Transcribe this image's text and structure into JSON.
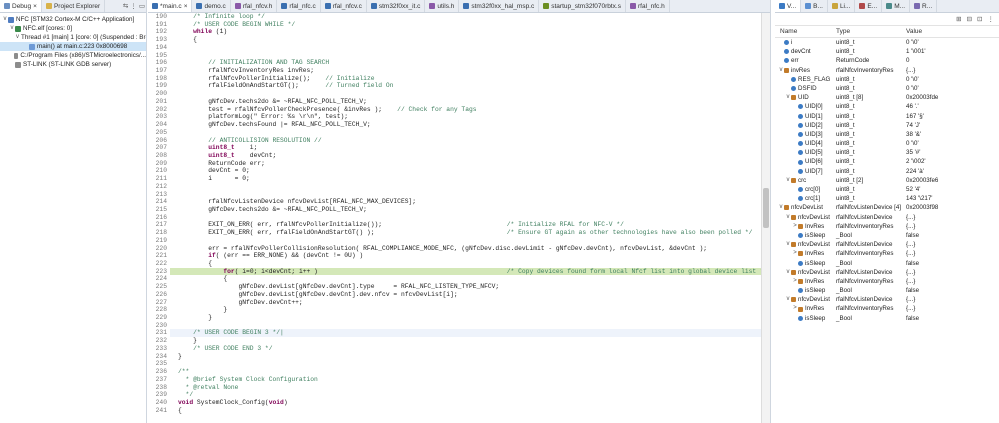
{
  "debug_view": {
    "tabs": [
      "Debug",
      "Project Explorer"
    ],
    "tree": [
      {
        "indent": 0,
        "twisty": "v",
        "label": "NFC [STM32 Cortex-M C/C++ Application]",
        "icon": "app"
      },
      {
        "indent": 1,
        "twisty": "v",
        "label": "NFC.elf [cores: 0]",
        "icon": "elf"
      },
      {
        "indent": 2,
        "twisty": "v",
        "label": "Thread #1 [main] 1 [core: 0] (Suspended : Breakpoint)",
        "icon": "thread"
      },
      {
        "indent": 3,
        "twisty": "",
        "label": "main() at main.c:223 0x8000698",
        "icon": "frame",
        "selected": true
      },
      {
        "indent": 1,
        "twisty": "",
        "label": "C:/Program Files (x86)/STMicroelectronics/...",
        "icon": "gdb"
      },
      {
        "indent": 1,
        "twisty": "",
        "label": "ST-LINK (ST-LINK GDB server)",
        "icon": "gdb"
      }
    ]
  },
  "editor": {
    "tabs": [
      {
        "label": "*main.c",
        "close": "×",
        "kind": "c",
        "active": true
      },
      {
        "label": "demo.c",
        "kind": "c"
      },
      {
        "label": "rfal_nfcv.h",
        "kind": "h"
      },
      {
        "label": "rfal_nfc.c",
        "kind": "c"
      },
      {
        "label": "rfal_nfcv.c",
        "kind": "c"
      },
      {
        "label": "stm32f0xx_it.c",
        "kind": "c"
      },
      {
        "label": "utils.h",
        "kind": "h"
      },
      {
        "label": "stm32f0xx_hal_msp.c",
        "kind": "c"
      },
      {
        "label": "startup_stm32f070rbtx.s",
        "kind": "s"
      },
      {
        "label": "rfal_nfc.h",
        "kind": "h"
      }
    ],
    "lines": [
      {
        "n": "190",
        "t": "    /* Infinite loop */"
      },
      {
        "n": "191",
        "t": "    /* USER CODE BEGIN WHILE */"
      },
      {
        "n": "192",
        "t": "    while (1)"
      },
      {
        "n": "193",
        "t": "    {"
      },
      {
        "n": "194",
        "t": ""
      },
      {
        "n": "195",
        "t": ""
      },
      {
        "n": "196",
        "t": "        // INITIALIZATION AND TAG SEARCH"
      },
      {
        "n": "197",
        "t": "        rfalNfcvInventoryRes invRes;"
      },
      {
        "n": "198",
        "t": "        rfalNfcvPollerInitialize();    // Initialize"
      },
      {
        "n": "199",
        "t": "        rfalFieldOnAndStartGT();       // Turned field On"
      },
      {
        "n": "200",
        "t": ""
      },
      {
        "n": "201",
        "t": "        gNfcDev.techs2do &= ~RFAL_NFC_POLL_TECH_V;"
      },
      {
        "n": "202",
        "t": "        test = rfalNfcvPollerCheckPresence( &invRes );    // Check for any Tags"
      },
      {
        "n": "203",
        "t": "        platformLog(\" Error: %s \\r\\n\", test);"
      },
      {
        "n": "204",
        "t": "        gNfcDev.techsFound |= RFAL_NFC_POLL_TECH_V;"
      },
      {
        "n": "205",
        "t": ""
      },
      {
        "n": "206",
        "t": "        // ANTICOLLISION RESOLUTION //"
      },
      {
        "n": "207",
        "t": "        uint8_t    i;"
      },
      {
        "n": "208",
        "t": "        uint8_t    devCnt;"
      },
      {
        "n": "209",
        "t": "        ReturnCode err;"
      },
      {
        "n": "210",
        "t": "        devCnt = 0;"
      },
      {
        "n": "211",
        "t": "        i      = 0;"
      },
      {
        "n": "212",
        "t": ""
      },
      {
        "n": "213",
        "t": ""
      },
      {
        "n": "214",
        "t": "        rfalNfcvListenDevice nfcvDevList[RFAL_NFC_MAX_DEVICES];"
      },
      {
        "n": "215",
        "t": "        gNfcDev.techs2do &= ~RFAL_NFC_POLL_TECH_V;"
      },
      {
        "n": "216",
        "t": ""
      },
      {
        "n": "217",
        "t": "        EXIT_ON_ERR( err, rfalNfcvPollerInitialize());                                 /* Initialize RFAL for NFC-V */"
      },
      {
        "n": "218",
        "t": "        EXIT_ON_ERR( err, rfalFieldOnAndStartGT() );                                   /* Ensure GT again as other technologies have also been polled */"
      },
      {
        "n": "219",
        "t": ""
      },
      {
        "n": "220",
        "t": "        err = rfalNfcvPollerCollisionResolution( RFAL_COMPLIANCE_MODE_NFC, (gNfcDev.disc.devLimit - gNfcDev.devCnt), nfcvDevList, &devCnt );"
      },
      {
        "n": "221",
        "t": "        if( (err == ERR_NONE) && (devCnt != 0U) )"
      },
      {
        "n": "222",
        "t": "        {"
      },
      {
        "n": "223",
        "t": "            for( i=0; i<devCnt; i++ )                                                  /* Copy devices found form local Nfcf list into global device list */",
        "hl": true
      },
      {
        "n": "224",
        "t": "            {"
      },
      {
        "n": "225",
        "t": "                gNfcDev.devList[gNfcDev.devCnt].type     = RFAL_NFC_LISTEN_TYPE_NFCV;"
      },
      {
        "n": "226",
        "t": "                gNfcDev.devList[gNfcDev.devCnt].dev.nfcv = nfcvDevList[i];"
      },
      {
        "n": "227",
        "t": "                gNfcDev.devCnt++;"
      },
      {
        "n": "228",
        "t": "            }"
      },
      {
        "n": "229",
        "t": "        }"
      },
      {
        "n": "230",
        "t": ""
      },
      {
        "n": "231",
        "t": "    /* USER CODE BEGIN 3 */|",
        "cur": true
      },
      {
        "n": "232",
        "t": "    }"
      },
      {
        "n": "233",
        "t": "    /* USER CODE END 3 */"
      },
      {
        "n": "234",
        "t": "}"
      },
      {
        "n": "235",
        "t": ""
      },
      {
        "n": "236",
        "t": "/**"
      },
      {
        "n": "237",
        "t": "  * @brief System Clock Configuration"
      },
      {
        "n": "238",
        "t": "  * @retval None"
      },
      {
        "n": "239",
        "t": "  */"
      },
      {
        "n": "240",
        "t": "void SystemClock_Config(void)"
      },
      {
        "n": "241",
        "t": "{"
      }
    ]
  },
  "variables_view": {
    "tabs": [
      "V...",
      "B...",
      "Li...",
      "E...",
      "M...",
      "R..."
    ],
    "columns": [
      "Name",
      "Type",
      "Value"
    ],
    "rows": [
      {
        "d": 0,
        "tw": "",
        "name": "i",
        "type": "uint8_t",
        "value": "0 '\\0'"
      },
      {
        "d": 0,
        "tw": "",
        "name": "devCnt",
        "type": "uint8_t",
        "value": "1 '\\001'"
      },
      {
        "d": 0,
        "tw": "",
        "name": "err",
        "type": "ReturnCode",
        "value": "0"
      },
      {
        "d": 0,
        "tw": "v",
        "name": "invRes",
        "type": "rfalNfcvInventoryRes",
        "value": "{...}",
        "struct": true
      },
      {
        "d": 1,
        "tw": "",
        "name": "RES_FLAG",
        "type": "uint8_t",
        "value": "0 '\\0'"
      },
      {
        "d": 1,
        "tw": "",
        "name": "DSFID",
        "type": "uint8_t",
        "value": "0 '\\0'"
      },
      {
        "d": 1,
        "tw": "v",
        "name": "UID",
        "type": "uint8_t [8]",
        "value": "0x20003fde",
        "struct": true
      },
      {
        "d": 2,
        "tw": "",
        "name": "UID[0]",
        "type": "uint8_t",
        "value": "46 '.'"
      },
      {
        "d": 2,
        "tw": "",
        "name": "UID[1]",
        "type": "uint8_t",
        "value": "167 '§'"
      },
      {
        "d": 2,
        "tw": "",
        "name": "UID[2]",
        "type": "uint8_t",
        "value": "74 'J'"
      },
      {
        "d": 2,
        "tw": "",
        "name": "UID[3]",
        "type": "uint8_t",
        "value": "38 '&'"
      },
      {
        "d": 2,
        "tw": "",
        "name": "UID[4]",
        "type": "uint8_t",
        "value": "0 '\\0'"
      },
      {
        "d": 2,
        "tw": "",
        "name": "UID[5]",
        "type": "uint8_t",
        "value": "35 '#'"
      },
      {
        "d": 2,
        "tw": "",
        "name": "UID[6]",
        "type": "uint8_t",
        "value": "2 '\\002'"
      },
      {
        "d": 2,
        "tw": "",
        "name": "UID[7]",
        "type": "uint8_t",
        "value": "224 'à'"
      },
      {
        "d": 1,
        "tw": "v",
        "name": "crc",
        "type": "uint8_t [2]",
        "value": "0x20003fe6",
        "struct": true
      },
      {
        "d": 2,
        "tw": "",
        "name": "crc[0]",
        "type": "uint8_t",
        "value": "52 '4'"
      },
      {
        "d": 2,
        "tw": "",
        "name": "crc[1]",
        "type": "uint8_t",
        "value": "143 '\\217'"
      },
      {
        "d": 0,
        "tw": "v",
        "name": "nfcvDevList",
        "type": "rfalNfcvListenDevice [4]",
        "value": "0x20003f98",
        "struct": true
      },
      {
        "d": 1,
        "tw": "v",
        "name": "nfcvDevList",
        "type": "rfalNfcvListenDevice",
        "value": "{...}",
        "struct": true
      },
      {
        "d": 2,
        "tw": ">",
        "name": "InvRes",
        "type": "rfalNfcvInventoryRes",
        "value": "{...}",
        "struct": true
      },
      {
        "d": 2,
        "tw": "",
        "name": "isSleep",
        "type": "_Bool",
        "value": "false"
      },
      {
        "d": 1,
        "tw": "v",
        "name": "nfcvDevList",
        "type": "rfalNfcvListenDevice",
        "value": "{...}",
        "struct": true
      },
      {
        "d": 2,
        "tw": ">",
        "name": "InvRes",
        "type": "rfalNfcvInventoryRes",
        "value": "{...}",
        "struct": true
      },
      {
        "d": 2,
        "tw": "",
        "name": "isSleep",
        "type": "_Bool",
        "value": "false"
      },
      {
        "d": 1,
        "tw": "v",
        "name": "nfcvDevList",
        "type": "rfalNfcvListenDevice",
        "value": "{...}",
        "struct": true
      },
      {
        "d": 2,
        "tw": ">",
        "name": "InvRes",
        "type": "rfalNfcvInventoryRes",
        "value": "{...}",
        "struct": true
      },
      {
        "d": 2,
        "tw": "",
        "name": "isSleep",
        "type": "_Bool",
        "value": "false"
      },
      {
        "d": 1,
        "tw": "v",
        "name": "nfcvDevList",
        "type": "rfalNfcvListenDevice",
        "value": "{...}",
        "struct": true
      },
      {
        "d": 2,
        "tw": ">",
        "name": "InvRes",
        "type": "rfalNfcvInventoryRes",
        "value": "{...}",
        "struct": true
      },
      {
        "d": 2,
        "tw": "",
        "name": "isSleep",
        "type": "_Bool",
        "value": "false"
      }
    ]
  },
  "colors": {
    "highlight": "#d4e8b8",
    "selection": "#cde4f7",
    "keyword": "#7f0055",
    "comment": "#3f7f5f",
    "field": "#0000c0"
  }
}
